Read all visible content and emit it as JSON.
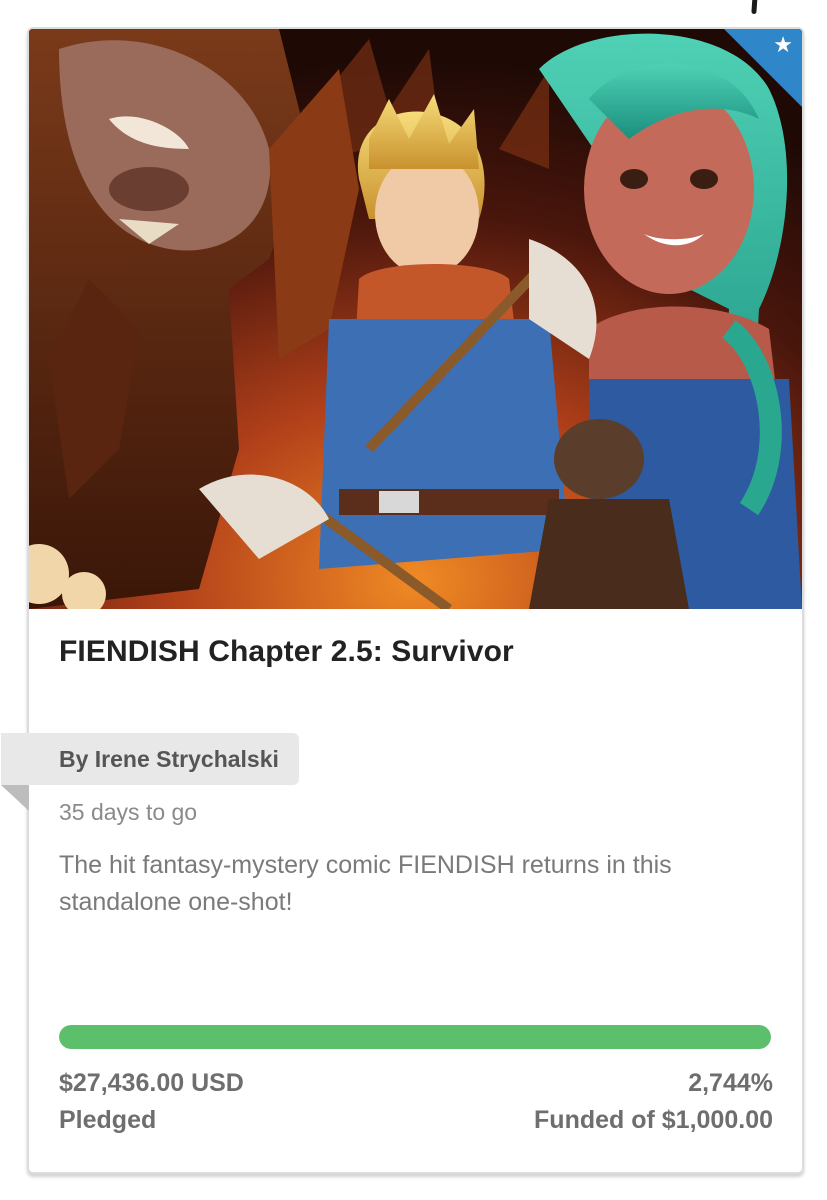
{
  "card": {
    "title": "FIENDISH Chapter 2.5: Survivor",
    "author": "By Irene Strychalski",
    "days_left": "35 days to go",
    "description": "The hit fantasy-mystery comic FIENDISH returns in this standalone one-shot!",
    "featured_icon": "star-icon",
    "cover_image": "comic-cover-art",
    "progress": {
      "fraction": 1.0,
      "color": "#5cbf6c"
    },
    "pledged_amount": "$27,436.00 USD",
    "pledged_label": "Pledged",
    "funded_percent": "2,744%",
    "funded_label": "Funded of $1,000.00"
  },
  "colors": {
    "ribbon": "#2f86c8",
    "progress": "#5cbf6c",
    "author_tag_bg": "#e8e8e8"
  }
}
